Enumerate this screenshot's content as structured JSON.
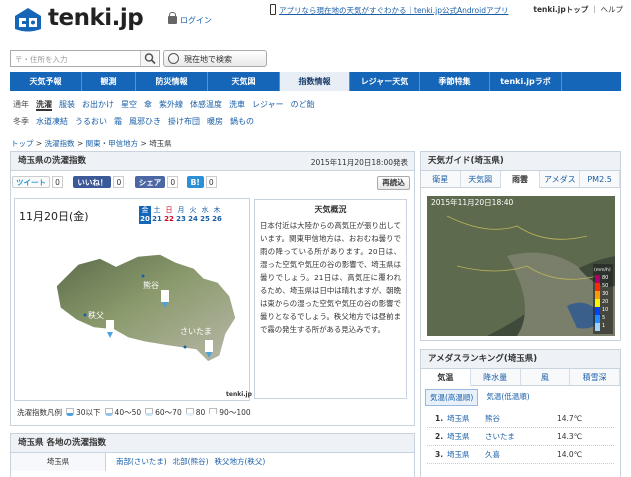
{
  "header": {
    "logo": "tenki.jp",
    "login": "ログイン",
    "promo": "アプリなら現在地の天気がすぐわかる｜tenki.jp公式Androidアプリ",
    "top_link": "tenki.jpトップ",
    "help_link": "ヘルプ",
    "search_placeholder": "〒・住所を入力",
    "current_location_button": "現在地で検索"
  },
  "nav": [
    "天気予報",
    "観測",
    "防災情報",
    "天気図",
    "指数情報",
    "レジャー天気",
    "季節特集",
    "tenki.jpラボ"
  ],
  "subnav_row1": [
    "通年",
    "洗濯",
    "服装",
    "お出かけ",
    "星空",
    "傘",
    "紫外線",
    "体感温度",
    "洗車",
    "レジャー",
    "のど飴"
  ],
  "subnav_row2": [
    "冬季",
    "水道凍結",
    "うるおい",
    "霜",
    "風邪ひき",
    "掛け布団",
    "暖房",
    "鍋もの"
  ],
  "breadcrumb": [
    "トップ",
    "洗濯指数",
    "関東・甲信地方",
    "埼玉県"
  ],
  "main": {
    "title": "埼玉県の洗濯指数",
    "published": "2015年11月20日18:00発表",
    "tweet": "ツイート",
    "tweet_count": "0",
    "like": "いいね！",
    "like_count": "0",
    "share": "シェア",
    "share_count": "0",
    "hatena_count": "0",
    "reload": "再読込",
    "date": "11月20日(金)",
    "day_names": [
      "金",
      "土",
      "日",
      "月",
      "火",
      "水",
      "木"
    ],
    "day_nums": [
      "20",
      "21",
      "22",
      "23",
      "24",
      "25",
      "26"
    ],
    "map_labels": [
      "熊谷",
      "秩父",
      "さいたま"
    ],
    "map_credit": "tenki.jp",
    "explanation_title": "天気概況",
    "explanation": "日本付近は大陸からの高気圧が張り出しています。関東甲信地方は、おおむね曇りで雨の降っている所があります。20日は、湿った空気や気圧の谷の影響で、埼玉県は曇りでしょう。21日は、高気圧に覆われるため、埼玉県は日中は晴れますが、朝晩は東からの湿った空気や気圧の谷の影響で曇りとなるでしょう。秩父地方では昼前まで霧の発生する所がある見込みです。",
    "legend_title": "洗濯指数凡例",
    "legend": [
      "30以下",
      "40〜50",
      "60〜70",
      "80",
      "90〜100"
    ],
    "sub_title": "埼玉県 各地の洗濯指数",
    "sub_region": "埼玉県",
    "sub_areas": [
      "南部(さいたま)",
      "北部(熊谷)",
      "秩父地方(秩父)"
    ]
  },
  "guide": {
    "title": "天気ガイド(埼玉県)",
    "tabs": [
      "衛星",
      "天気図",
      "雨雲",
      "アメダス",
      "PM2.5"
    ],
    "timestamp": "2015年11月20日18:40",
    "scale": [
      "80",
      "50",
      "30",
      "20",
      "10",
      "5",
      "1"
    ],
    "scale_unit": "(mm/h)"
  },
  "ranking": {
    "title": "アメダスランキング(埼玉県)",
    "tabs": [
      "気温",
      "降水量",
      "風",
      "積雪深"
    ],
    "subtabs": [
      "気温(高温順)",
      "気温(低温順)"
    ],
    "rows": [
      {
        "rank": "1.",
        "pref": "埼玉県",
        "city": "熊谷",
        "value": "14.7℃"
      },
      {
        "rank": "2.",
        "pref": "埼玉県",
        "city": "さいたま",
        "value": "14.3℃"
      },
      {
        "rank": "3.",
        "pref": "埼玉県",
        "city": "久喜",
        "value": "14.0℃"
      }
    ]
  },
  "colors": {
    "nav": "#1565b8",
    "accent": "#1a5fa8",
    "sunday": "#d0021b",
    "saturday": "#1a5fa8"
  }
}
